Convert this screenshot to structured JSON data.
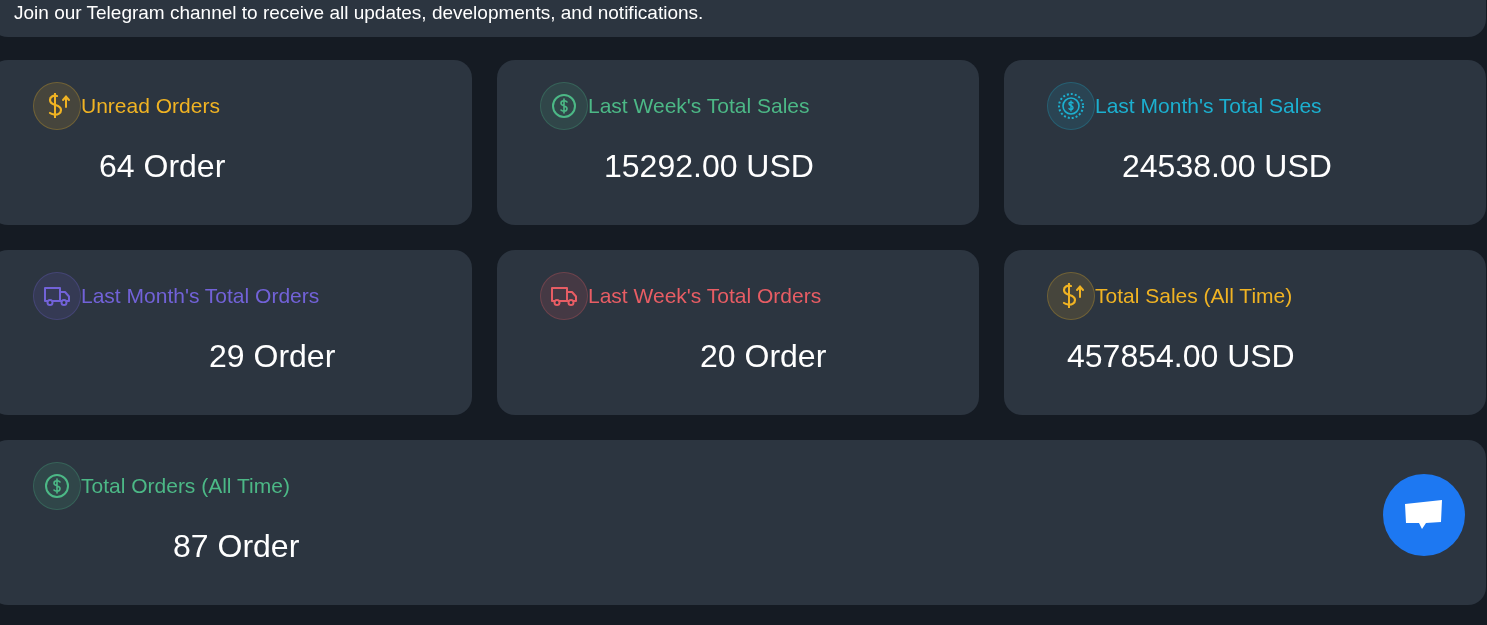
{
  "banner": {
    "text": "Join our Telegram channel to receive all updates, developments, and notifications."
  },
  "cards": [
    {
      "title": "Unread Orders",
      "value": "64 Order",
      "kind": "dollar-up",
      "color": "#f0b323"
    },
    {
      "title": "Last Week's Total Sales",
      "value": "15292.00 USD",
      "kind": "dollar-circle",
      "color": "#4cb886"
    },
    {
      "title": "Last Month's Total Sales",
      "value": "24538.00 USD",
      "kind": "dollar-badge",
      "color": "#1cb0d0"
    },
    {
      "title": "Last Month's Total Orders",
      "value": "29 Order",
      "kind": "truck",
      "color": "#7262d8"
    },
    {
      "title": "Last Week's Total Orders",
      "value": "20 Order",
      "kind": "truck",
      "color": "#e85d64"
    },
    {
      "title": "Total Sales (All Time)",
      "value": "457854.00 USD",
      "kind": "dollar-up",
      "color": "#f0b323"
    },
    {
      "title": "Total Orders (All Time)",
      "value": "87 Order",
      "kind": "dollar-circle",
      "color": "#4cb886"
    }
  ]
}
